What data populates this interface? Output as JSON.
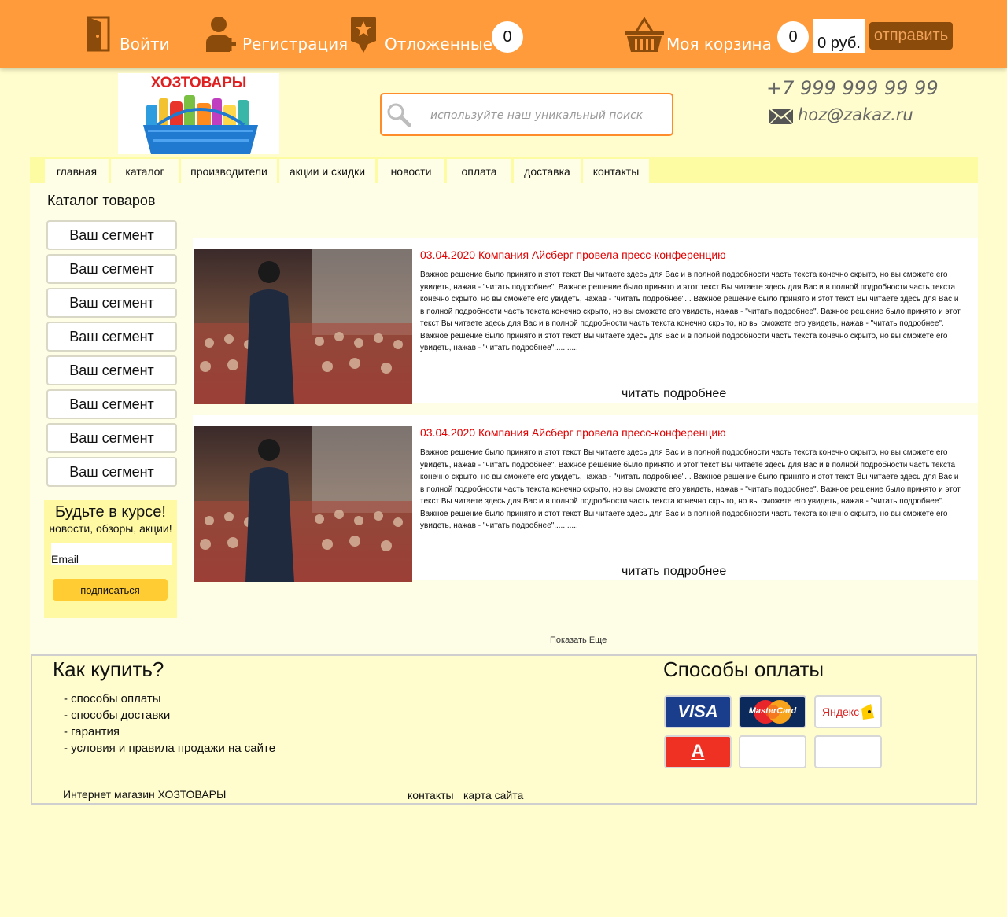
{
  "header": {
    "login_label": "Войти",
    "register_label": "Регистрация",
    "saved_label": "Отложенные",
    "saved_count": "0",
    "cart_label": "Моя корзина",
    "cart_count": "0",
    "cart_total": "0 руб.",
    "send_label": "отправить"
  },
  "logo": {
    "text": "ХОЗТОВАРЫ"
  },
  "search": {
    "placeholder": "используйте наш уникальный поиск"
  },
  "contacts": {
    "phone": "+7 999 999 99 99",
    "email": "hoz@zakaz.ru"
  },
  "nav": [
    "главная",
    "каталог",
    "производители",
    "акции и скидки",
    "новости",
    "оплата",
    "доставка",
    "контакты"
  ],
  "catalog": {
    "title": "Каталог товаров",
    "segments": [
      "Ваш сегмент",
      "Ваш сегмент",
      "Ваш сегмент",
      "Ваш сегмент",
      "Ваш сегмент",
      "Ваш сегмент",
      "Ваш сегмент",
      "Ваш сегмент"
    ]
  },
  "subscribe": {
    "title": "Будьте в курсе!",
    "subtitle": "новости, обзоры, акции!",
    "email_placeholder": "Email",
    "button": "подписаться"
  },
  "news": [
    {
      "title": "03.04.2020 Компания Айсберг провела пресс-конференцию",
      "text": "Важное решение было принято и этот текст Вы читаете здесь  для Вас и в полной подробности часть текста конечно скрыто, но вы сможете его увидеть, нажав - \"читать подробнее\". Важное решение было принято и этот текст Вы читаете здесь  для Вас и в полной подробности часть текста конечно скрыто, но вы сможете его увидеть, нажав - \"читать подробнее\". . Важное решение было принято и этот текст Вы читаете здесь  для Вас и в полной подробности часть текста конечно скрыто, но вы сможете его увидеть, нажав - \"читать подробнее\".  Важное решение было принято и этот текст Вы читаете здесь  для Вас и в полной подробности часть текста конечно скрыто, но вы сможете его увидеть, нажав - \"читать подробнее\".  Важное решение было принято и этот текст Вы читаете здесь  для Вас и в полной подробности часть текста конечно скрыто, но вы сможете его увидеть, нажав - \"читать подробнее\"...........",
      "more": "читать подробнее"
    },
    {
      "title": "03.04.2020 Компания Айсберг провела пресс-конференцию",
      "text": "Важное решение было принято и этот текст Вы читаете здесь  для Вас и в полной подробности часть текста конечно скрыто, но вы сможете его увидеть, нажав - \"читать подробнее\". Важное решение было принято и этот текст Вы читаете здесь  для Вас и в полной подробности часть текста конечно скрыто, но вы сможете его увидеть, нажав - \"читать подробнее\". . Важное решение было принято и этот текст Вы читаете здесь  для Вас и в полной подробности часть текста конечно скрыто, но вы сможете его увидеть, нажав - \"читать подробнее\".  Важное решение было принято и этот текст Вы читаете здесь  для Вас и в полной подробности часть текста конечно скрыто, но вы сможете его увидеть, нажав - \"читать подробнее\".  Важное решение было принято и этот текст Вы читаете здесь  для Вас и в полной подробности часть текста конечно скрыто, но вы сможете его увидеть, нажав - \"читать подробнее\"...........",
      "more": "читать подробнее"
    }
  ],
  "show_more": "Показать Еще",
  "footer": {
    "how_to_buy_title": "Как купить?",
    "links": [
      "- способы оплаты",
      "- способы доставки",
      "- гарантия",
      "- условия и правила продажи на сайте"
    ],
    "payment_title": "Способы оплаты",
    "payment_methods": [
      "VISA",
      "MasterCard",
      "Яндекс",
      "А"
    ],
    "shop_name": "Интернет магазин ХОЗТОВАРЫ",
    "contacts_link": "контакты",
    "sitemap_link": "карта сайта"
  },
  "colors": {
    "topbar": "#ff9b3a",
    "page_bg": "#fffdcd",
    "accent_red": "#e20000",
    "icon_brown": "#8b4b0a"
  }
}
